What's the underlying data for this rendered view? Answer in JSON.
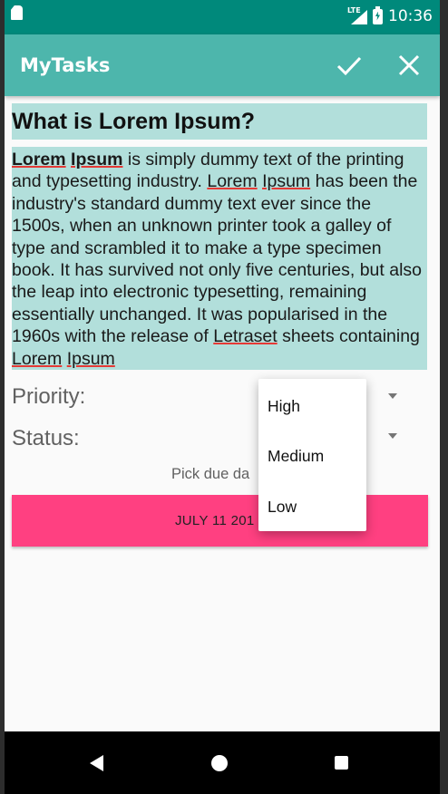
{
  "status_bar": {
    "lte_label": "LTE",
    "time": "10:36"
  },
  "app_bar": {
    "title": "MyTasks",
    "actions": [
      "check-icon",
      "close-icon"
    ]
  },
  "task": {
    "title": "What is Lorem Ipsum?",
    "body_segments": [
      "Lorem",
      " ",
      "Ipsum",
      " is simply dummy text of the printing and typesetting industry. ",
      "Lorem",
      " ",
      "Ipsum",
      " has been the industry's standard dummy text ever since the 1500s, when an unknown printer took a galley of type and scrambled it to make a type specimen book. It has survived not only five centuries, but also the leap into electronic typesetting, remaining essentially unchanged. It was popularised in the 1960s with the release of ",
      "Letraset",
      " sheets containing ",
      "Lorem",
      " ",
      "Ipsum"
    ]
  },
  "form": {
    "priority_label": "Priority:",
    "status_label": "Status:",
    "pick_due_date_label": "Pick due da",
    "due_date_button": "JULY 11 201"
  },
  "priority_menu": {
    "options": [
      "High",
      "Medium",
      "Low"
    ]
  },
  "nav_bar": {
    "icons": [
      "back-icon",
      "home-icon",
      "recents-icon"
    ]
  },
  "colors": {
    "status_bar": "#00897b",
    "app_bar": "#4db6ac",
    "highlight": "#b2dfdb",
    "accent": "#ff4081"
  }
}
